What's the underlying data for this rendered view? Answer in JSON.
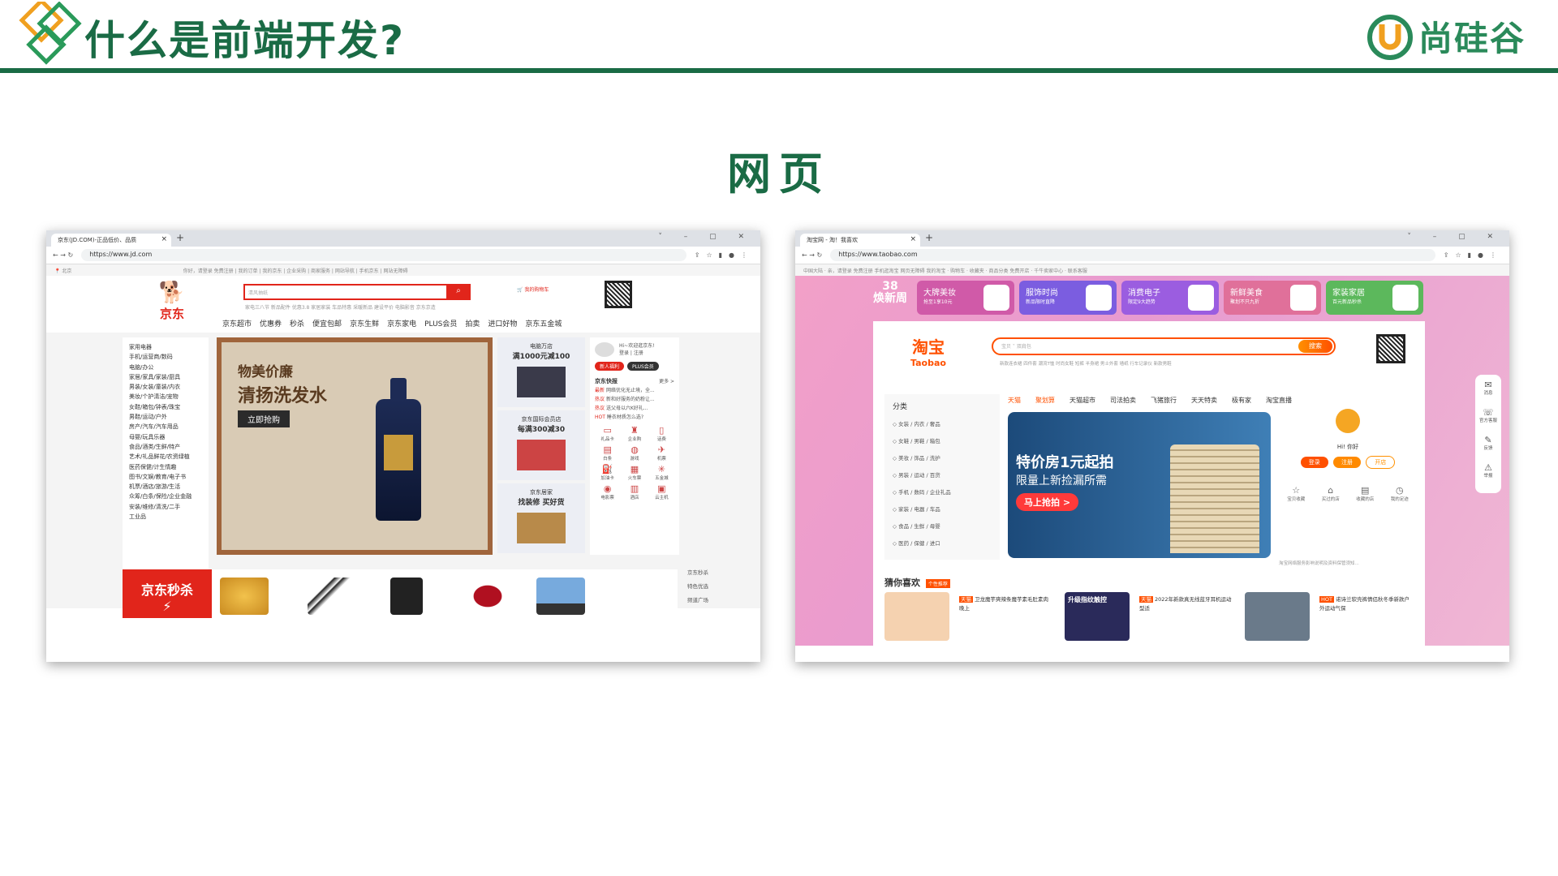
{
  "slide": {
    "title": "什么是前端开发?",
    "section_title": "网页",
    "brand": "尚硅谷",
    "colors": {
      "primary": "#1a6b45",
      "brand_green": "#2a8a5a",
      "jd_red": "#e1251b",
      "taobao_orange": "#ff5000"
    }
  },
  "jd": {
    "tab_title": "京东(JD.COM)-正品低价、品质",
    "url": "https://www.jd.com",
    "location": "北京",
    "top_links": "你好，请登录 免费注册 | 我的订单 | 我的京东 | 企业采购 | 商家服务 | 网站导航 | 手机京东 | 网站无障碍",
    "logo_text": "京东",
    "search_placeholder": "清风抽纸",
    "hot_words": "家电三八节  新品配件  优惠3.8  家居家装  车品特惠  采暖新品  建设平价  电脑影音  京东京造",
    "cart_label": "我的购物车",
    "nav": [
      "京东超市",
      "优惠券",
      "秒杀",
      "便宜包邮",
      "京东生鲜",
      "京东家电",
      "PLUS会员",
      "拍卖",
      "进口好物",
      "京东五金城"
    ],
    "categories": [
      "家用电器",
      "手机/运营商/数码",
      "电脑/办公",
      "家居/家具/家装/厨具",
      "男装/女装/童装/内衣",
      "美妆/个护清洁/宠物",
      "女鞋/箱包/钟表/珠宝",
      "男鞋/运动/户外",
      "房产/汽车/汽车用品",
      "母婴/玩具乐器",
      "食品/酒类/生鲜/特产",
      "艺术/礼品鲜花/农资绿植",
      "医药保健/计生情趣",
      "图书/文娱/教育/电子书",
      "机票/酒店/旅游/生活",
      "众筹/白条/保险/企业金融",
      "安装/维修/清洗/二手",
      "工业品"
    ],
    "banner": {
      "line1": "物美价廉",
      "line2": "清扬洗发水",
      "cta": "立即抢购"
    },
    "promos": [
      {
        "sub": "电脑万店",
        "title": "满1000元减100"
      },
      {
        "sub": "京东国际会员店",
        "title": "每满300减30"
      },
      {
        "sub": "京东居家",
        "title": "找装修 买好货"
      }
    ],
    "welcome": "Hi~欢迎逛京东!",
    "login": "登录 | 注册",
    "pill_new": "新人福利",
    "pill_plus": "PLUS会员",
    "news_title": "京东快报",
    "news_more": "更多 >",
    "news": [
      {
        "tag": "最新",
        "text": "网络优化无止境，全..."
      },
      {
        "tag": "热议",
        "text": "新和好服务的奶粉让..."
      },
      {
        "tag": "热议",
        "text": "送父母以六K好礼..."
      },
      {
        "tag": "HOT",
        "text": "睡衣材质怎么选?"
      }
    ],
    "services": [
      {
        "icon": "▭",
        "label": "礼品卡"
      },
      {
        "icon": "♜",
        "label": "企业购"
      },
      {
        "icon": "▯",
        "label": "话费"
      },
      {
        "icon": "▤",
        "label": "白条"
      },
      {
        "icon": "◍",
        "label": "游戏"
      },
      {
        "icon": "✈",
        "label": "机票"
      },
      {
        "icon": "⛽",
        "label": "加油卡"
      },
      {
        "icon": "▦",
        "label": "火车票"
      },
      {
        "icon": "✳",
        "label": "五金城"
      },
      {
        "icon": "◉",
        "label": "电影票"
      },
      {
        "icon": "▥",
        "label": "酒店"
      },
      {
        "icon": "▣",
        "label": "云主机"
      }
    ],
    "seckill": "京东秒杀",
    "right_nav": [
      "京东秒杀",
      "特色优选",
      "频道广场"
    ]
  },
  "taobao": {
    "tab_title": "淘宝网 - 淘！我喜欢",
    "url": "https://www.taobao.com",
    "top_links": "中国大陆 · 亲，请登录  免费注册  手机逛淘宝  网页无障碍          我的淘宝 · 购物车 · 收藏夹 · 商品分类  免费开店 · 千牛卖家中心 · 联系客服",
    "week_line1": "38",
    "week_line2": "焕新周",
    "promos": [
      {
        "title": "大牌美妆",
        "sub": "抢至1享10元",
        "color": "#d05aa8"
      },
      {
        "title": "服饰时尚",
        "sub": "新品限时直降",
        "color": "#7b5de0"
      },
      {
        "title": "消费电子",
        "sub": "限定9大趋势",
        "color": "#9b5de0"
      },
      {
        "title": "新鲜美食",
        "sub": "聚划不只九折",
        "color": "#e0709a"
      },
      {
        "title": "家装家居",
        "sub": "百元新品秒杀",
        "color": "#5cb85c"
      }
    ],
    "logo_cn": "淘宝",
    "logo_en": "Taobao",
    "search_placeholder": "宝贝 ˅  双肩包",
    "search_button": "搜索",
    "hot_words": "新款连衣裙  四件套  潮流T恤  时尚女鞋  短裤  半身裙  男士外套  墙纸  行车记录仪  新款男鞋",
    "category_title": "分类",
    "categories": [
      "女装 / 内衣 / 奢品",
      "女鞋 / 男鞋 / 箱包",
      "美妆 / 饰品 / 洗护",
      "男装 / 运动 / 百货",
      "手机 / 数码 / 企业礼品",
      "家装 / 电器 / 车品",
      "食品 / 生鲜 / 母婴",
      "医药 / 保健 / 进口"
    ],
    "channels": [
      "天猫",
      "聚划算",
      "天猫超市",
      "司法拍卖",
      "飞猪旅行",
      "天天特卖",
      "极有家",
      "淘宝直播"
    ],
    "banner": {
      "line1": "特价房1元起拍",
      "line2": "限量上新捡漏所需",
      "cta": "马上抢拍 >"
    },
    "greeting": "Hi! 你好",
    "btn_login": "登录",
    "btn_register": "注册",
    "btn_open": "开店",
    "quick": [
      {
        "icon": "☆",
        "label": "宝贝收藏"
      },
      {
        "icon": "⌂",
        "label": "买过的店"
      },
      {
        "icon": "▤",
        "label": "收藏的店"
      },
      {
        "icon": "◷",
        "label": "我的足迹"
      }
    ],
    "notice": "淘宝网络服务影响说明及资料保管须知...",
    "guess_title": "猜你喜欢",
    "guess_tag": "个性推荐",
    "items": [
      {
        "tag": "天猫",
        "text": "卫龙魔芋爽辣条魔芋素毛肚素肉晚上"
      },
      {
        "tag": "天猫",
        "text": "2022年新款真无线蓝牙耳机运动型适"
      },
      {
        "tag": "HOT",
        "text": "诺诗兰软壳裤情侣秋冬季新款户外运动气保"
      }
    ],
    "item_banner": "升级指纹触控",
    "side": [
      {
        "icon": "✉",
        "label": "消息"
      },
      {
        "icon": "☏",
        "label": "官方客服"
      },
      {
        "icon": "✎",
        "label": "反馈"
      },
      {
        "icon": "⚠",
        "label": "举报"
      }
    ]
  }
}
